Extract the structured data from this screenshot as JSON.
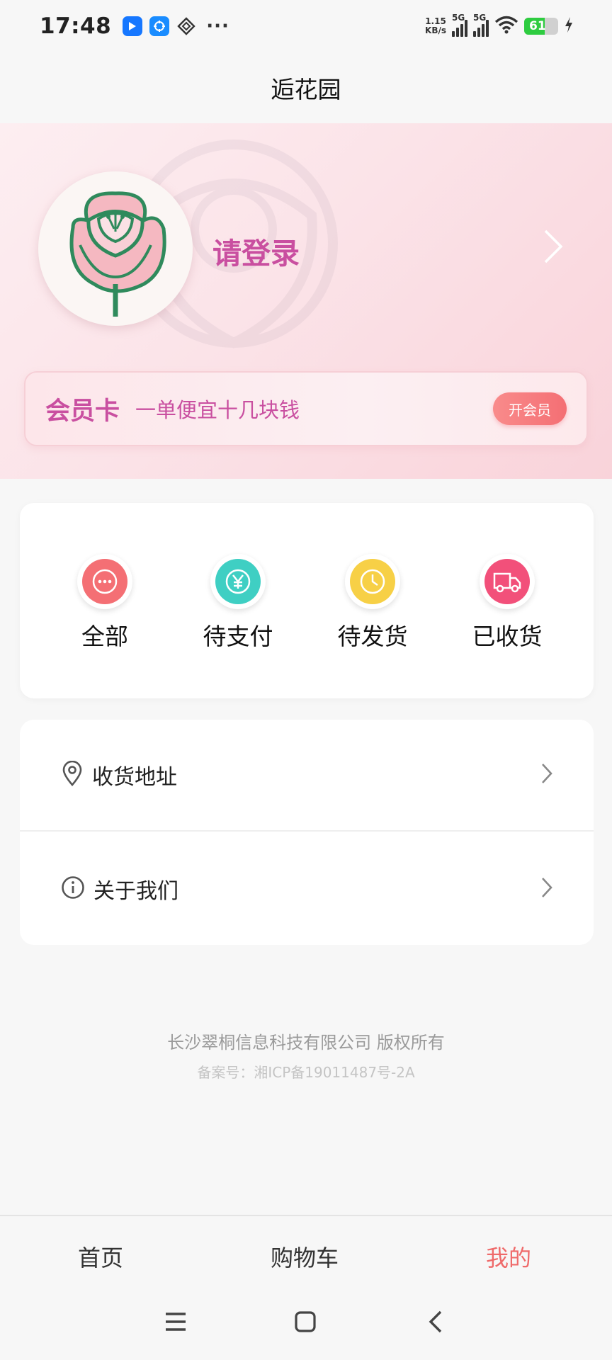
{
  "status_bar": {
    "time": "17:48",
    "net_speed_value": "1.15",
    "net_speed_unit": "KB/s",
    "signal1_label": "5G",
    "signal2_label": "5G",
    "battery_level": "61",
    "icons": [
      "app-blue-icon",
      "app-calendar-icon",
      "app-diamond-icon",
      "more-dots-icon",
      "signal-icon",
      "signal-icon",
      "wifi-icon",
      "battery-icon",
      "charging-icon"
    ]
  },
  "header": {
    "title": "逅花园"
  },
  "profile": {
    "login_text": "请登录",
    "avatar_icon": "rose-icon"
  },
  "member_card": {
    "title": "会员卡",
    "desc": "一单便宜十几块钱",
    "button": "开会员"
  },
  "orders": [
    {
      "label": "全部",
      "icon": "more-dots-icon",
      "color": "#f46f74"
    },
    {
      "label": "待支付",
      "icon": "yen-icon",
      "color": "#3fcfc3"
    },
    {
      "label": "待发货",
      "icon": "clock-icon",
      "color": "#f7d046"
    },
    {
      "label": "已收货",
      "icon": "truck-icon",
      "color": "#f2507a"
    }
  ],
  "menu": [
    {
      "label": "收货地址",
      "icon": "location-pin-icon"
    },
    {
      "label": "关于我们",
      "icon": "info-icon"
    }
  ],
  "footer": {
    "company": "长沙翠桐信息科技有限公司 版权所有",
    "icp": "备案号：湘ICP备19011487号-2A"
  },
  "tabs": [
    {
      "label": "首页",
      "active": false
    },
    {
      "label": "购物车",
      "active": false
    },
    {
      "label": "我的",
      "active": true
    }
  ],
  "colors": {
    "accent": "#c94fa0",
    "active_tab": "#ef6a6a",
    "join_button": "#f46f74"
  }
}
